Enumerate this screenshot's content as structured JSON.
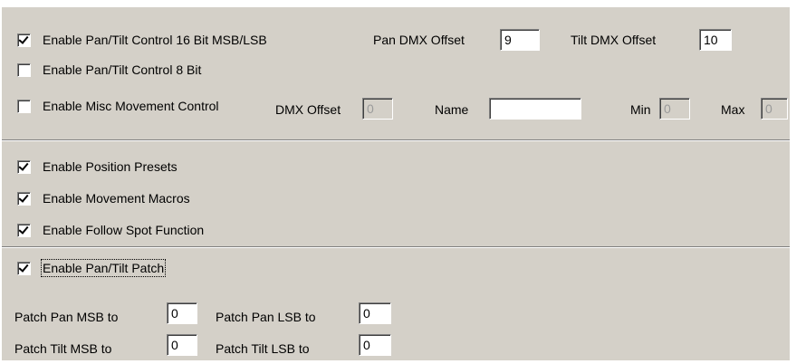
{
  "movement": {
    "pan_tilt_16bit": {
      "label": "Enable Pan/Tilt Control 16 Bit MSB/LSB",
      "checked": true
    },
    "pan_dmx_offset": {
      "label": "Pan DMX Offset",
      "value": "9"
    },
    "tilt_dmx_offset": {
      "label": "Tilt DMX Offset",
      "value": "10"
    },
    "pan_tilt_8bit": {
      "label": "Enable Pan/Tilt Control 8 Bit",
      "checked": false
    },
    "misc_movement": {
      "label": "Enable Misc Movement Control",
      "checked": false
    },
    "misc_dmx_offset": {
      "label": "DMX Offset",
      "value": "0"
    },
    "misc_name": {
      "label": "Name",
      "value": ""
    },
    "misc_min": {
      "label": "Min",
      "value": "0"
    },
    "misc_max": {
      "label": "Max",
      "value": "0"
    }
  },
  "features": {
    "position_presets": {
      "label": "Enable Position Presets",
      "checked": true
    },
    "movement_macros": {
      "label": "Enable Movement Macros",
      "checked": true
    },
    "follow_spot": {
      "label": "Enable Follow Spot Function",
      "checked": true
    }
  },
  "patch": {
    "enable": {
      "label": "Enable Pan/Tilt Patch",
      "checked": true
    },
    "pan_msb": {
      "label": "Patch Pan MSB to",
      "value": "0"
    },
    "pan_lsb": {
      "label": "Patch Pan LSB to",
      "value": "0"
    },
    "tilt_msb": {
      "label": "Patch Tilt MSB to",
      "value": "0"
    },
    "tilt_lsb": {
      "label": "Patch Tilt LSB to",
      "value": "0"
    }
  }
}
